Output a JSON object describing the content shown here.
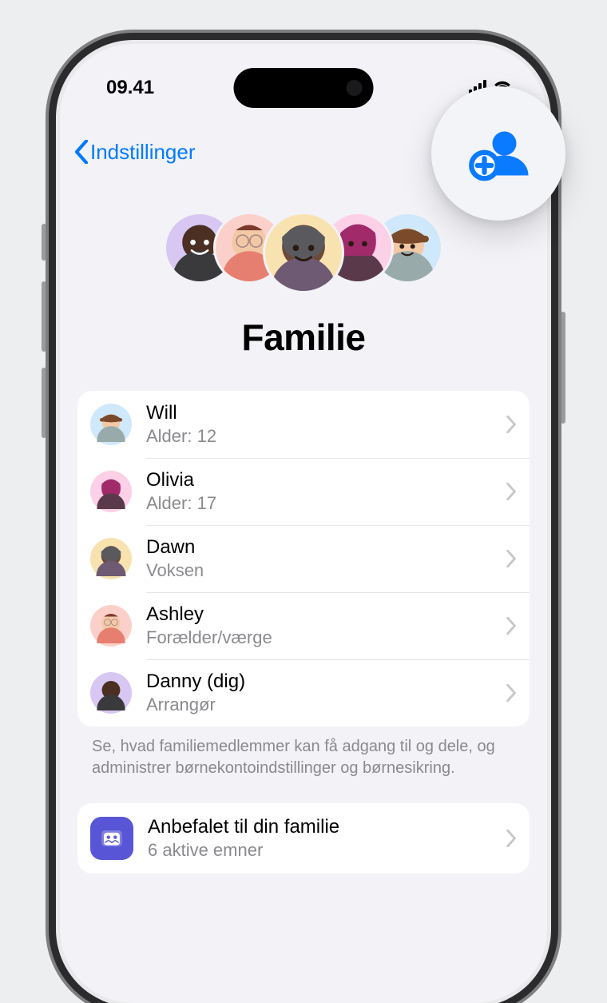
{
  "statusbar": {
    "time": "09.41"
  },
  "nav": {
    "back_label": "Indstillinger"
  },
  "header": {
    "title": "Familie"
  },
  "members": [
    {
      "name": "Will",
      "subtitle": "Alder: 12"
    },
    {
      "name": "Olivia",
      "subtitle": "Alder: 17"
    },
    {
      "name": "Dawn",
      "subtitle": "Voksen"
    },
    {
      "name": "Ashley",
      "subtitle": "Forælder/værge"
    },
    {
      "name": "Danny (dig)",
      "subtitle": "Arrangør"
    }
  ],
  "members_footer": "Se, hvad familiemedlemmer kan få adgang til og dele, og administrer børnekontoindstillinger og børnesikring.",
  "recommended": {
    "title": "Anbefalet til din familie",
    "subtitle": "6 aktive emner"
  },
  "colors": {
    "accent": "#007aff",
    "background": "#f2f2f7",
    "card": "#ffffff",
    "secondary_text": "#8a8a8e"
  }
}
